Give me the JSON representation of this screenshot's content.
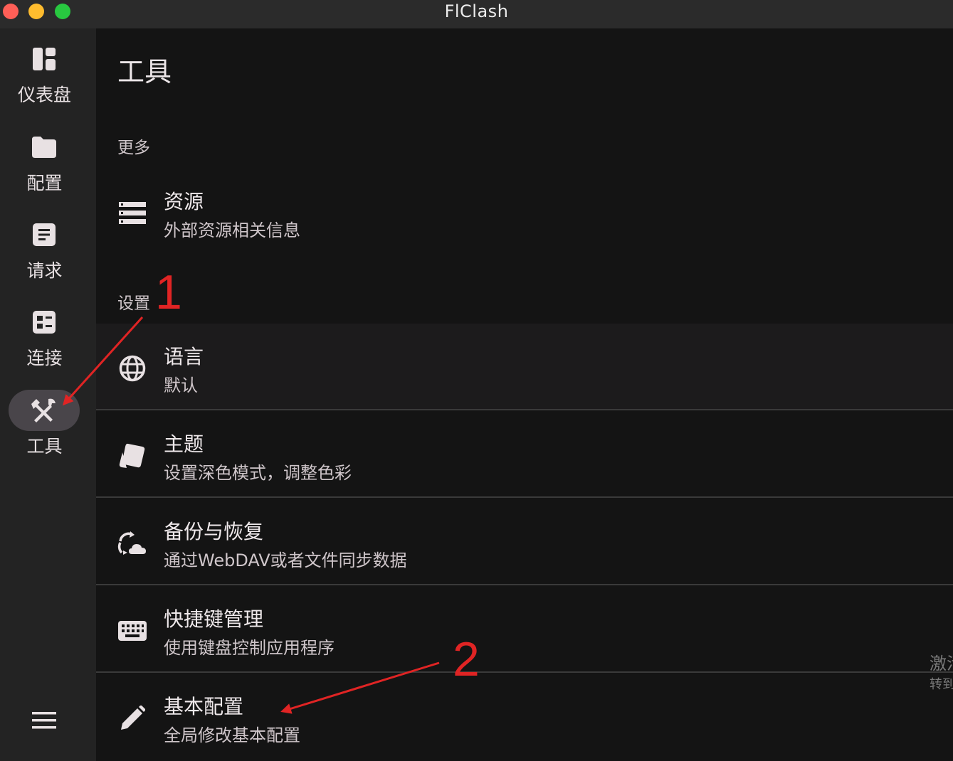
{
  "window": {
    "title": "FlClash"
  },
  "sidebar": {
    "items": [
      {
        "label": "仪表盘",
        "icon": "dashboard-icon"
      },
      {
        "label": "配置",
        "icon": "folder-icon"
      },
      {
        "label": "请求",
        "icon": "article-icon"
      },
      {
        "label": "连接",
        "icon": "connections-icon"
      },
      {
        "label": "工具",
        "icon": "tools-icon",
        "active": true
      }
    ],
    "menu_icon": "menu-icon"
  },
  "main": {
    "title": "工具",
    "sections": [
      {
        "label": "更多"
      },
      {
        "label": "设置"
      }
    ],
    "items": [
      {
        "title": "资源",
        "subtitle": "外部资源相关信息",
        "icon": "storage-icon"
      },
      {
        "title": "语言",
        "subtitle": "默认",
        "icon": "globe-icon"
      },
      {
        "title": "主题",
        "subtitle": "设置深色模式，调整色彩",
        "icon": "palette-icon"
      },
      {
        "title": "备份与恢复",
        "subtitle": "通过WebDAV或者文件同步数据",
        "icon": "cloud-sync-icon"
      },
      {
        "title": "快捷键管理",
        "subtitle": "使用键盘控制应用程序",
        "icon": "keyboard-icon"
      },
      {
        "title": "基本配置",
        "subtitle": "全局修改基本配置",
        "icon": "edit-icon"
      }
    ]
  },
  "overlay": {
    "line1": "激活",
    "line2": "转到"
  },
  "annotations": [
    {
      "number": "1"
    },
    {
      "number": "2"
    }
  ],
  "colors": {
    "annotation": "#e02424",
    "active_pill": "#49454a",
    "background": "#141414"
  }
}
